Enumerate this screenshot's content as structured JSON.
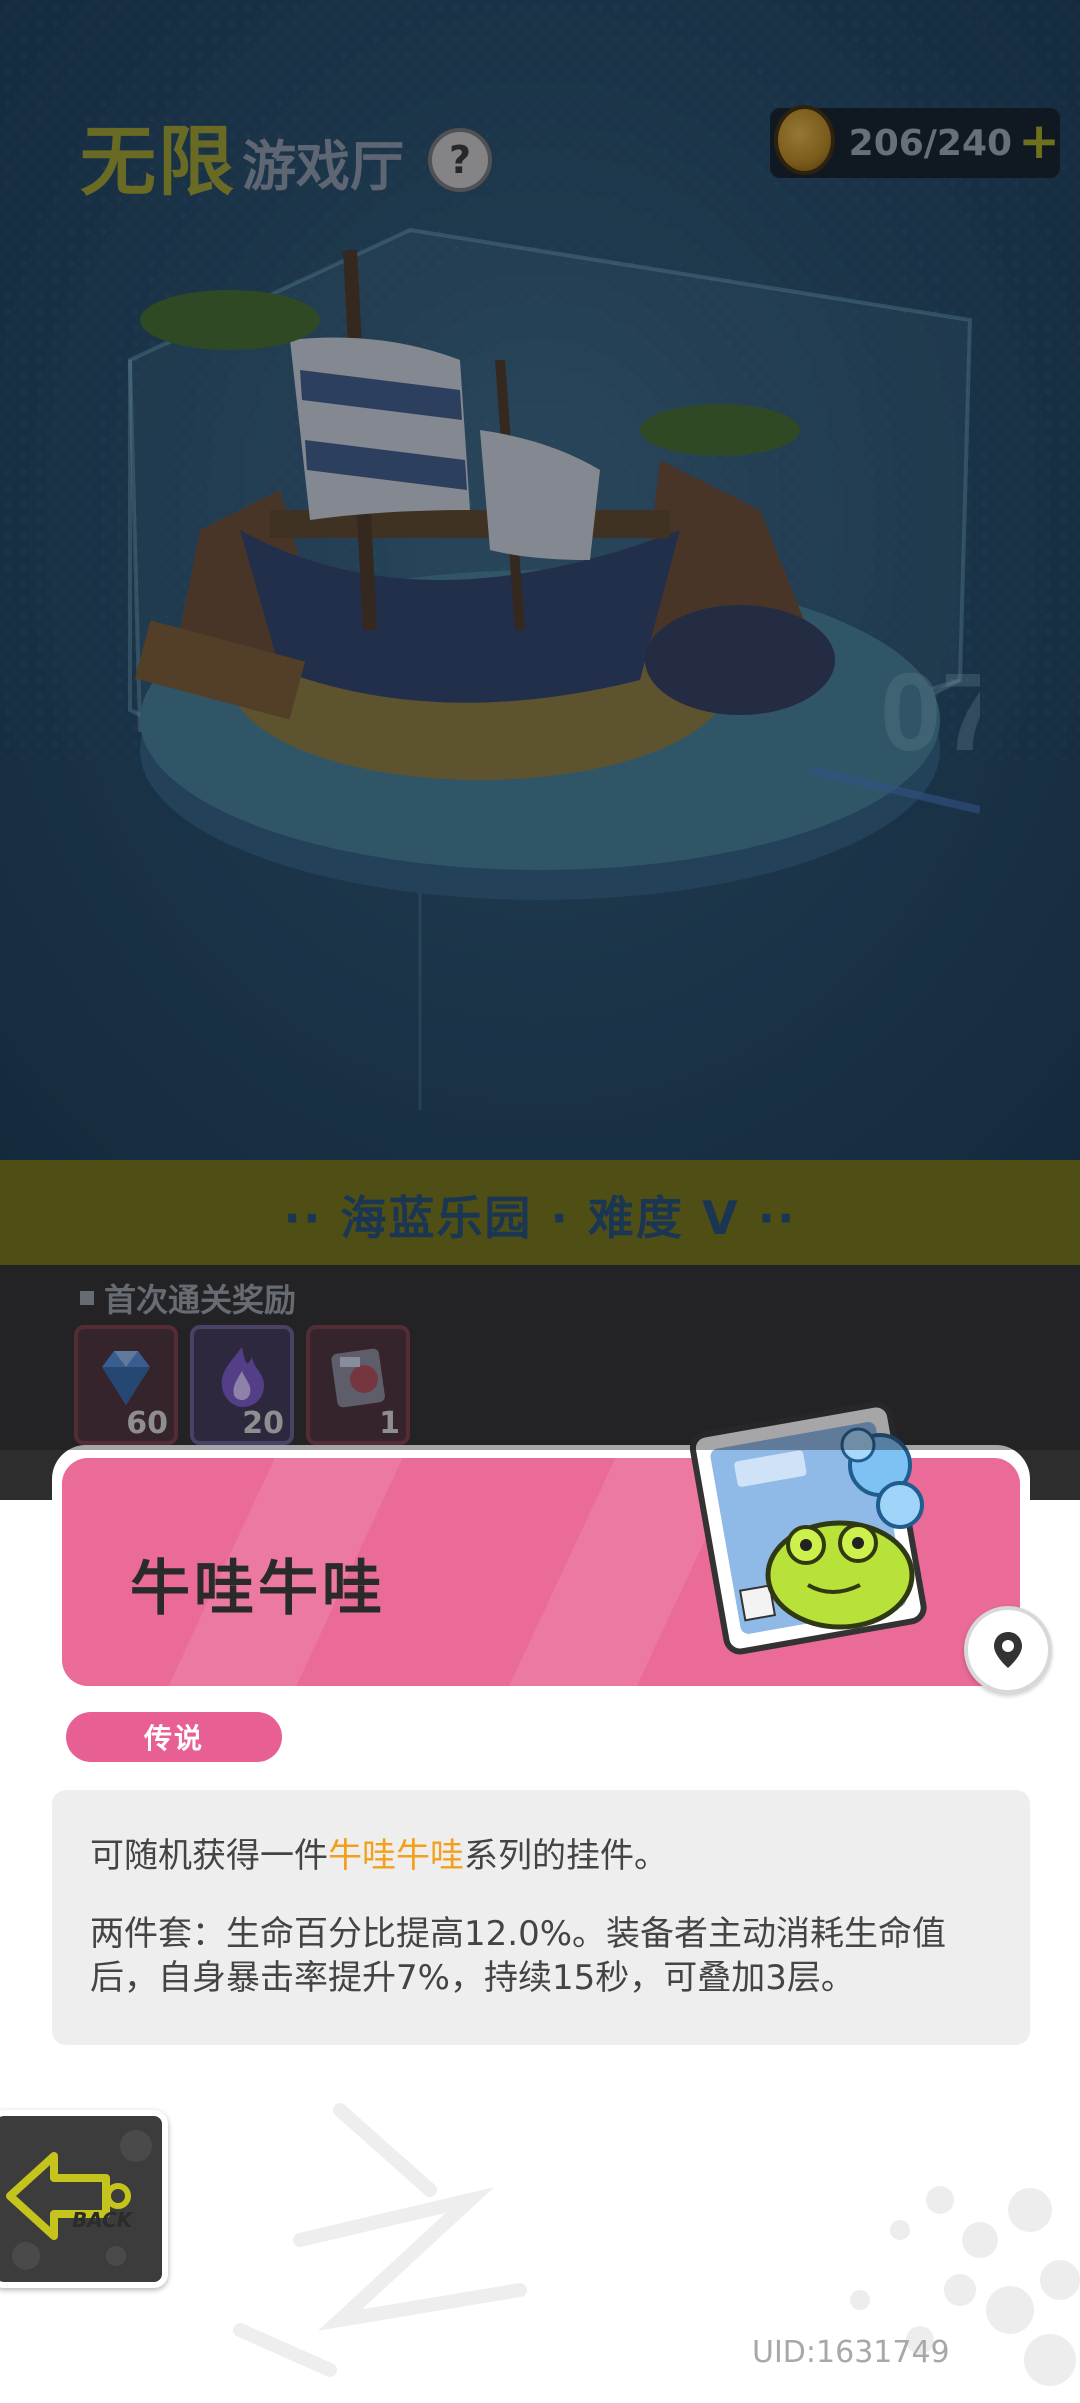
{
  "header": {
    "title_highlight": "无限",
    "title_rest": "游戏厅",
    "help_symbol": "?",
    "coins": "206/240",
    "coin_plus": "+"
  },
  "stage": {
    "label": "·· 海蓝乐园 · 难度 V ··"
  },
  "rewards": {
    "title": "首次通关奖励",
    "items": [
      {
        "icon": "diamond-icon",
        "count": "60"
      },
      {
        "icon": "flame-icon",
        "count": "20"
      },
      {
        "icon": "charm-box-icon",
        "count": "1"
      }
    ]
  },
  "item": {
    "name": "牛哇牛哇",
    "rarity": "传说",
    "desc_pre": "可随机获得一件",
    "desc_highlight": "牛哇牛哇",
    "desc_post": "系列的挂件。",
    "set_bonus": "两件套：生命百分比提高12.0%。装备者主动消耗生命值后，自身暴击率提升7%，持续15秒，可叠加3层。"
  },
  "nav": {
    "back_label": "BACK"
  },
  "footer": {
    "uid": "UID:1631749"
  },
  "colors": {
    "accent_pink": "#ea6a98",
    "highlight_orange": "#f2a01a",
    "stage_band": "#727211"
  }
}
